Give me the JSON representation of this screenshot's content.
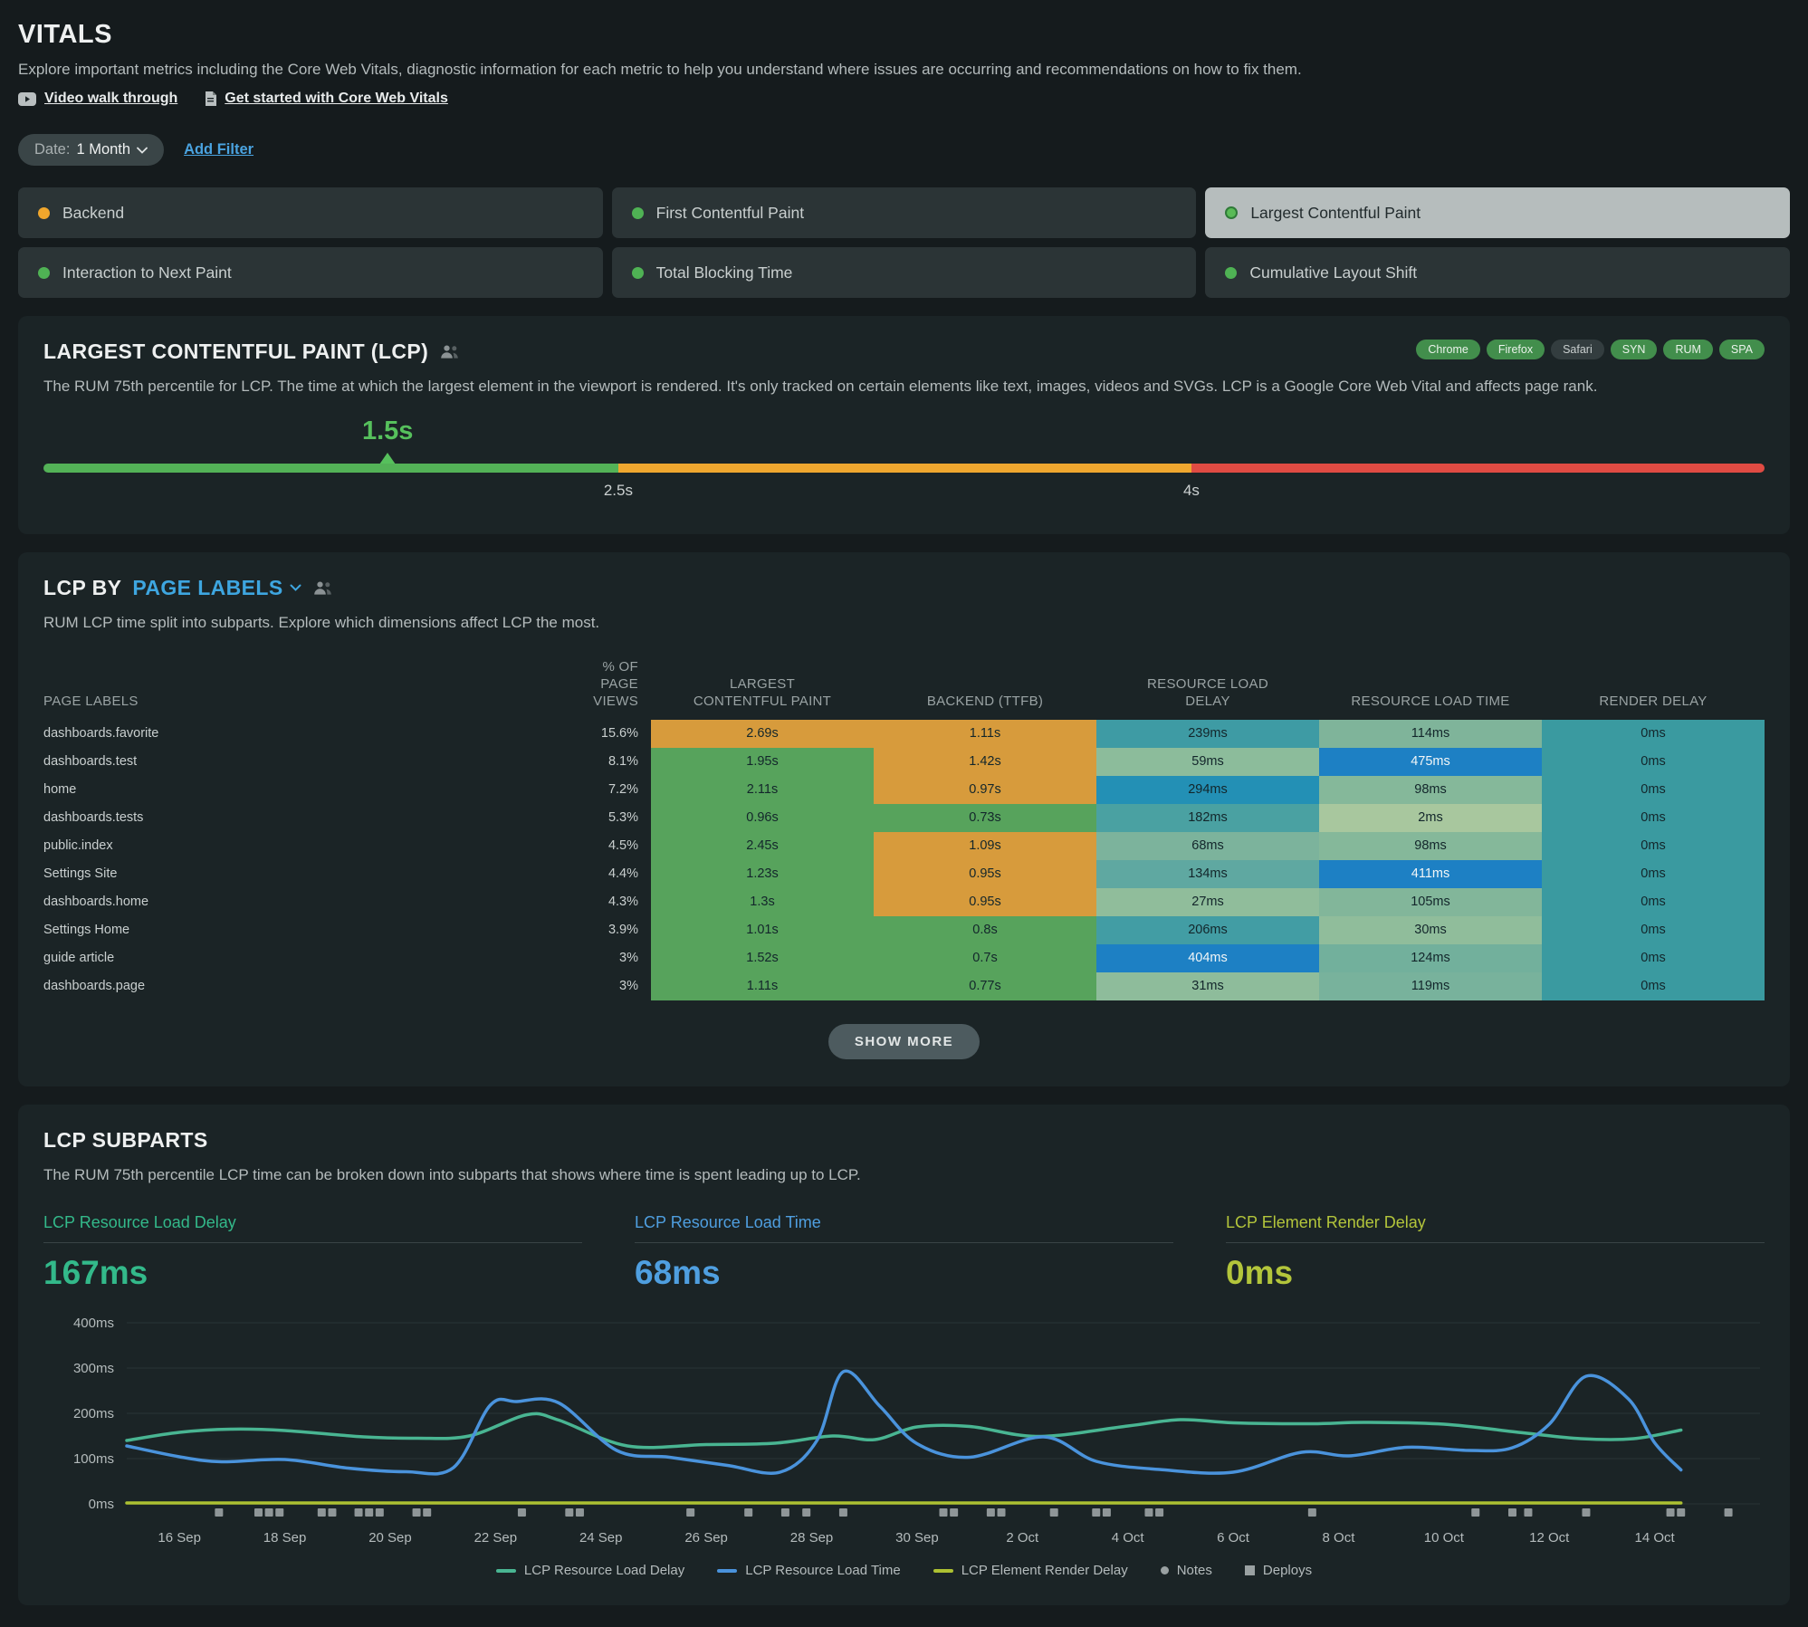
{
  "page": {
    "title": "VITALS",
    "description": "Explore important metrics including the Core Web Vitals, diagnostic information for each metric to help you understand where issues are occurring and recommendations on how to fix them.",
    "links": [
      {
        "label": "Video walk through",
        "icon": "youtube-icon"
      },
      {
        "label": "Get started with Core Web Vitals",
        "icon": "document-icon"
      }
    ]
  },
  "filters": {
    "date_label": "Date:",
    "date_value": "1 Month",
    "add_filter_label": "Add Filter"
  },
  "metric_tabs": [
    {
      "label": "Backend",
      "dot_color": "#f0a62c",
      "selected": false
    },
    {
      "label": "First Contentful Paint",
      "dot_color": "#4fb254",
      "selected": false
    },
    {
      "label": "Largest Contentful Paint",
      "dot_color": "#5abb57",
      "selected": true
    },
    {
      "label": "Interaction to Next Paint",
      "dot_color": "#4fb254",
      "selected": false
    },
    {
      "label": "Total Blocking Time",
      "dot_color": "#4fb254",
      "selected": false
    },
    {
      "label": "Cumulative Layout Shift",
      "dot_color": "#4fb254",
      "selected": false
    }
  ],
  "lcp_panel": {
    "title": "LARGEST CONTENTFUL PAINT (LCP)",
    "badges": [
      {
        "label": "Chrome",
        "type": "green"
      },
      {
        "label": "Firefox",
        "type": "green"
      },
      {
        "label": "Safari",
        "type": "gray"
      },
      {
        "label": "SYN",
        "type": "green"
      },
      {
        "label": "RUM",
        "type": "green"
      },
      {
        "label": "SPA",
        "type": "green"
      }
    ],
    "description": "The RUM 75th percentile for LCP. The time at which the largest element in the viewport is rendered. It's only tracked on certain elements like text, images, videos and SVGs. LCP is a Google Core Web Vital and affects page rank.",
    "gauge": {
      "value_label": "1.5s",
      "value_pct": 20,
      "segments": [
        {
          "color": "#53b257",
          "width_pct": 33.4
        },
        {
          "color": "#efa72f",
          "width_pct": 33.3
        },
        {
          "color": "#e04b43",
          "width_pct": 33.3
        }
      ],
      "threshold_labels": [
        {
          "label": "2.5s",
          "pct": 33.4
        },
        {
          "label": "4s",
          "pct": 66.7
        }
      ]
    }
  },
  "page_labels_panel": {
    "title_prefix": "LCP BY",
    "title_dimension": "PAGE LABELS",
    "description": "RUM LCP time split into subparts. Explore which dimensions affect LCP the most.",
    "show_more_label": "SHOW MORE",
    "table": {
      "columns": [
        "PAGE LABELS",
        "% OF PAGE VIEWS",
        "LARGEST CONTENTFUL PAINT",
        "BACKEND (TTFB)",
        "RESOURCE LOAD DELAY",
        "RESOURCE LOAD TIME",
        "RENDER DELAY"
      ],
      "rows": [
        {
          "label": "dashboards.favorite",
          "views": "15.6%",
          "cells": [
            {
              "value": "2.69s",
              "bg": "#d79b3c"
            },
            {
              "value": "1.11s",
              "bg": "#d79b3c"
            },
            {
              "value": "239ms",
              "bg": "#3e9ba4"
            },
            {
              "value": "114ms",
              "bg": "#7fb49a"
            },
            {
              "value": "0ms",
              "bg": "#3a9aa0"
            }
          ]
        },
        {
          "label": "dashboards.test",
          "views": "8.1%",
          "cells": [
            {
              "value": "1.95s",
              "bg": "#57a35c"
            },
            {
              "value": "1.42s",
              "bg": "#d79b3c"
            },
            {
              "value": "59ms",
              "bg": "#8cbc9b"
            },
            {
              "value": "475ms",
              "bg": "#1d80c4",
              "light": true
            },
            {
              "value": "0ms",
              "bg": "#3a9aa0"
            }
          ]
        },
        {
          "label": "home",
          "views": "7.2%",
          "cells": [
            {
              "value": "2.11s",
              "bg": "#57a35c"
            },
            {
              "value": "0.97s",
              "bg": "#d79b3c"
            },
            {
              "value": "294ms",
              "bg": "#2390b5"
            },
            {
              "value": "98ms",
              "bg": "#85b89a"
            },
            {
              "value": "0ms",
              "bg": "#3a9aa0"
            }
          ]
        },
        {
          "label": "dashboards.tests",
          "views": "5.3%",
          "cells": [
            {
              "value": "0.96s",
              "bg": "#57a35c"
            },
            {
              "value": "0.73s",
              "bg": "#57a35c"
            },
            {
              "value": "182ms",
              "bg": "#4aa1a2"
            },
            {
              "value": "2ms",
              "bg": "#a8c79e"
            },
            {
              "value": "0ms",
              "bg": "#3a9aa0"
            }
          ]
        },
        {
          "label": "public.index",
          "views": "4.5%",
          "cells": [
            {
              "value": "2.45s",
              "bg": "#57a35c"
            },
            {
              "value": "1.09s",
              "bg": "#d79b3c"
            },
            {
              "value": "68ms",
              "bg": "#7cb39c"
            },
            {
              "value": "98ms",
              "bg": "#85b89a"
            },
            {
              "value": "0ms",
              "bg": "#3a9aa0"
            }
          ]
        },
        {
          "label": "Settings Site",
          "views": "4.4%",
          "cells": [
            {
              "value": "1.23s",
              "bg": "#57a35c"
            },
            {
              "value": "0.95s",
              "bg": "#d79b3c"
            },
            {
              "value": "134ms",
              "bg": "#5fa8a1"
            },
            {
              "value": "411ms",
              "bg": "#1d80c4",
              "light": true
            },
            {
              "value": "0ms",
              "bg": "#3a9aa0"
            }
          ]
        },
        {
          "label": "dashboards.home",
          "views": "4.3%",
          "cells": [
            {
              "value": "1.3s",
              "bg": "#57a35c"
            },
            {
              "value": "0.95s",
              "bg": "#d79b3c"
            },
            {
              "value": "27ms",
              "bg": "#90bd9b"
            },
            {
              "value": "105ms",
              "bg": "#82b69a"
            },
            {
              "value": "0ms",
              "bg": "#3a9aa0"
            }
          ]
        },
        {
          "label": "Settings Home",
          "views": "3.9%",
          "cells": [
            {
              "value": "1.01s",
              "bg": "#57a35c"
            },
            {
              "value": "0.8s",
              "bg": "#57a35c"
            },
            {
              "value": "206ms",
              "bg": "#429da4"
            },
            {
              "value": "30ms",
              "bg": "#90bd9b"
            },
            {
              "value": "0ms",
              "bg": "#3a9aa0"
            }
          ]
        },
        {
          "label": "guide article",
          "views": "3%",
          "cells": [
            {
              "value": "1.52s",
              "bg": "#57a35c"
            },
            {
              "value": "0.7s",
              "bg": "#57a35c"
            },
            {
              "value": "404ms",
              "bg": "#1d80c4",
              "light": true
            },
            {
              "value": "124ms",
              "bg": "#72b09c"
            },
            {
              "value": "0ms",
              "bg": "#3a9aa0"
            }
          ]
        },
        {
          "label": "dashboards.page",
          "views": "3%",
          "cells": [
            {
              "value": "1.11s",
              "bg": "#57a35c"
            },
            {
              "value": "0.77s",
              "bg": "#57a35c"
            },
            {
              "value": "31ms",
              "bg": "#8ebc9b"
            },
            {
              "value": "119ms",
              "bg": "#78b29c"
            },
            {
              "value": "0ms",
              "bg": "#3a9aa0"
            }
          ]
        }
      ]
    }
  },
  "subparts_panel": {
    "title": "LCP SUBPARTS",
    "description": "The RUM 75th percentile LCP time can be broken down into subparts that shows where time is spent leading up to LCP.",
    "metrics": [
      {
        "label": "LCP Resource Load Delay",
        "value": "167ms",
        "color": "#33b98a"
      },
      {
        "label": "LCP Resource Load Time",
        "value": "68ms",
        "color": "#4f9fe0"
      },
      {
        "label": "LCP Element Render Delay",
        "value": "0ms",
        "color": "#b3c53b"
      }
    ]
  },
  "chart_data": {
    "type": "line",
    "ylabel_ticks": [
      "0ms",
      "100ms",
      "200ms",
      "300ms",
      "400ms"
    ],
    "ylim": [
      0,
      400
    ],
    "x_tick_labels": [
      "16 Sep",
      "18 Sep",
      "20 Sep",
      "22 Sep",
      "24 Sep",
      "26 Sep",
      "28 Sep",
      "30 Sep",
      "2 Oct",
      "4 Oct",
      "6 Oct",
      "8 Oct",
      "10 Oct",
      "12 Oct",
      "14 Oct"
    ],
    "x_tick_days": [
      1,
      3,
      5,
      7,
      9,
      11,
      13,
      15,
      17,
      19,
      21,
      23,
      25,
      27,
      29
    ],
    "xlim_days": [
      0,
      31
    ],
    "grid": true,
    "legend_position": "bottom",
    "series": [
      {
        "name": "LCP Resource Load Delay",
        "color": "#49b592",
        "points": [
          [
            0,
            140
          ],
          [
            1,
            158
          ],
          [
            2,
            165
          ],
          [
            3,
            162
          ],
          [
            4.5,
            148
          ],
          [
            5.5,
            145
          ],
          [
            6.5,
            150
          ],
          [
            7.6,
            197
          ],
          [
            8.2,
            185
          ],
          [
            9.5,
            128
          ],
          [
            11,
            131
          ],
          [
            12.3,
            134
          ],
          [
            13.4,
            150
          ],
          [
            14.2,
            142
          ],
          [
            15,
            170
          ],
          [
            16,
            171
          ],
          [
            17.3,
            149
          ],
          [
            19,
            172
          ],
          [
            20,
            186
          ],
          [
            21,
            179
          ],
          [
            22.5,
            177
          ],
          [
            23.5,
            180
          ],
          [
            25,
            176
          ],
          [
            26.5,
            157
          ],
          [
            27.6,
            144
          ],
          [
            28.6,
            144
          ],
          [
            29.5,
            163
          ]
        ]
      },
      {
        "name": "LCP Resource Load Time",
        "color": "#4a93dc",
        "points": [
          [
            0,
            128
          ],
          [
            1,
            104
          ],
          [
            1.8,
            93
          ],
          [
            3,
            98
          ],
          [
            4.2,
            79
          ],
          [
            5.3,
            71
          ],
          [
            6.2,
            80
          ],
          [
            6.9,
            218
          ],
          [
            7.4,
            226
          ],
          [
            8.2,
            223
          ],
          [
            9.3,
            118
          ],
          [
            10.3,
            103
          ],
          [
            11.4,
            85
          ],
          [
            12.4,
            70
          ],
          [
            13.1,
            140
          ],
          [
            13.6,
            292
          ],
          [
            14.3,
            215
          ],
          [
            15,
            133
          ],
          [
            16,
            103
          ],
          [
            17.4,
            148
          ],
          [
            18.4,
            94
          ],
          [
            19.6,
            76
          ],
          [
            21,
            70
          ],
          [
            22.3,
            114
          ],
          [
            23.2,
            106
          ],
          [
            24.3,
            125
          ],
          [
            25.5,
            118
          ],
          [
            26.3,
            124
          ],
          [
            27,
            176
          ],
          [
            27.7,
            282
          ],
          [
            28.5,
            232
          ],
          [
            29,
            135
          ],
          [
            29.5,
            75
          ]
        ]
      },
      {
        "name": "LCP Element Render Delay",
        "color": "#adc132",
        "points": [
          [
            0,
            2
          ],
          [
            10,
            2
          ],
          [
            20,
            2
          ],
          [
            29.5,
            2
          ]
        ]
      }
    ],
    "deploy_days": [
      1.75,
      2.5,
      2.7,
      2.9,
      3.7,
      3.9,
      4.4,
      4.6,
      4.8,
      5.5,
      5.7,
      7.5,
      8.4,
      8.6,
      10.7,
      11.8,
      12.5,
      12.9,
      13.6,
      15.5,
      15.7,
      16.4,
      16.6,
      17.6,
      18.4,
      18.6,
      19.4,
      19.6,
      22.5,
      25.6,
      26.3,
      26.6,
      27.7,
      29.3,
      29.5,
      30.4
    ],
    "legend": [
      {
        "label": "LCP Resource Load Delay",
        "swatch": "line",
        "color": "#49b592"
      },
      {
        "label": "LCP Resource Load Time",
        "swatch": "line",
        "color": "#4a93dc"
      },
      {
        "label": "LCP Element Render Delay",
        "swatch": "line",
        "color": "#adc132"
      },
      {
        "label": "Notes",
        "swatch": "dot",
        "color": "#9aa1a2"
      },
      {
        "label": "Deploys",
        "swatch": "square",
        "color": "#9aa1a2"
      }
    ]
  }
}
